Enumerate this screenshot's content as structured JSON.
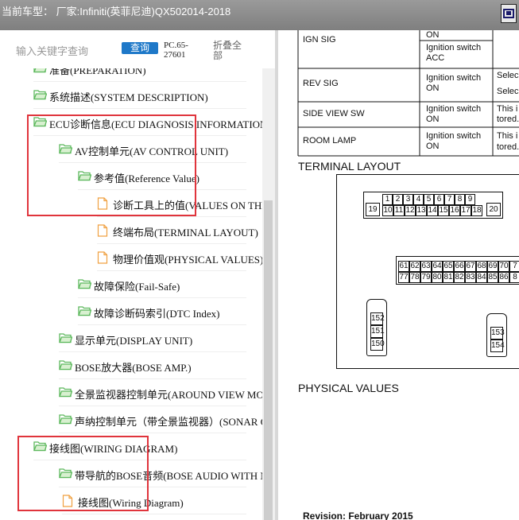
{
  "window": {
    "title": "当前车型：  厂家:Infiniti(英菲尼迪)QX502014-2018"
  },
  "search": {
    "placeholder": "输入关键字查询",
    "query_button": "查询",
    "pc_code": "PC.65-27601",
    "collapse_all": "折叠全部"
  },
  "tree": {
    "items": [
      {
        "label": "准备(PREPARATION)",
        "type": "folder",
        "depth": 1
      },
      {
        "label": "系统描述(SYSTEM DESCRIPTION)",
        "type": "folder",
        "depth": 1
      },
      {
        "label": "ECU诊断信息(ECU DIAGNOSIS INFORMATION)",
        "type": "folder",
        "depth": 1
      },
      {
        "label": "AV控制单元(AV CONTROL UNIT)",
        "type": "folder",
        "depth": 2
      },
      {
        "label": "参考值(Reference Value)",
        "type": "folder",
        "depth": 3
      },
      {
        "label": "诊断工具上的值(VALUES ON THE DIAGNOSIS TOOL)",
        "type": "page",
        "depth": 4
      },
      {
        "label": "终端布局(TERMINAL LAYOUT)",
        "type": "page",
        "depth": 4
      },
      {
        "label": "物理价值观(PHYSICAL VALUES)",
        "type": "page",
        "depth": 4
      },
      {
        "label": "故障保险(Fail-Safe)",
        "type": "folder",
        "depth": 3
      },
      {
        "label": "故障诊断码索引(DTC Index)",
        "type": "folder",
        "depth": 3
      },
      {
        "label": "显示单元(DISPLAY UNIT)",
        "type": "folder",
        "depth": 2
      },
      {
        "label": "BOSE放大器(BOSE AMP.)",
        "type": "folder",
        "depth": 2
      },
      {
        "label": "全景监视器控制单元(AROUND VIEW MONITOR CONTROL UNIT)",
        "type": "folder",
        "depth": 2
      },
      {
        "label": "声纳控制单元（带全景监视器）(SONAR CONTROL UNIT)",
        "type": "folder",
        "depth": 2
      },
      {
        "label": "接线图(WIRING DIAGRAM)",
        "type": "folder",
        "depth": 1
      },
      {
        "label": "带导航的BOSE音频(BOSE AUDIO WITH NAVIGATION)",
        "type": "folder",
        "depth": 2
      },
      {
        "label": "接线图(Wiring Diagram)",
        "type": "page",
        "depth": 3
      }
    ]
  },
  "document": {
    "table_rows": [
      {
        "name": "IGN SIG",
        "condition": "Ignition switch ON",
        "condition2": "Ignition switch ACC",
        "value": ""
      },
      {
        "name": "REV SIG",
        "condition": "Ignition switch ON",
        "value": "Selec",
        "value2": "Selec"
      },
      {
        "name": "SIDE VIEW SW",
        "condition": "Ignition switch ON",
        "value": "This i",
        "value2": "tored."
      },
      {
        "name": "ROOM LAMP",
        "condition": "Ignition switch ON",
        "value": "This i",
        "value2": "tored."
      }
    ],
    "terminal_layout_heading": "TERMINAL LAYOUT",
    "physical_values_heading": "PHYSICAL VALUES",
    "revision": "Revision: February 2015",
    "connector_top_row1": [
      "1",
      "2",
      "3",
      "4",
      "5",
      "6",
      "7",
      "8",
      "9"
    ],
    "connector_top_row2": [
      "10",
      "11",
      "12",
      "13",
      "14",
      "15",
      "16",
      "17",
      "18"
    ],
    "connector_top_left": "19",
    "connector_top_right": "20",
    "connector_mid_row1": [
      "61",
      "62",
      "63",
      "64",
      "65",
      "66",
      "67",
      "68",
      "69",
      "70",
      "7"
    ],
    "connector_mid_row2": [
      "77",
      "78",
      "79",
      "80",
      "81",
      "82",
      "83",
      "84",
      "85",
      "86",
      "8"
    ],
    "connector_small_left": [
      "152",
      "151",
      "150"
    ],
    "connector_small_right": [
      "153",
      "154"
    ],
    "top_cut_text": "ON"
  },
  "colors": {
    "highlight_box": "#e0343c",
    "query_button": "#1e78c8",
    "folder_icon": "#5cb85c",
    "page_icon": "#f0a040"
  }
}
